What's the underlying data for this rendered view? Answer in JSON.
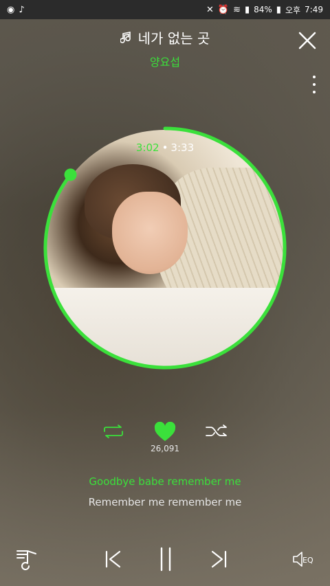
{
  "statusbar": {
    "battery": "84%",
    "ampm": "오후",
    "time": "7:49"
  },
  "track": {
    "title": "네가 없는 곳",
    "artist": "양요섭"
  },
  "progress": {
    "current": "3:02",
    "separator": "•",
    "total": "3:33",
    "fraction": 0.855
  },
  "likes": "26,091",
  "lyrics": {
    "current": "Goodbye babe remember me",
    "next": "Remember me remember me"
  },
  "colors": {
    "accent": "#3be03b"
  },
  "icons": [
    "music-note-icon",
    "close-icon",
    "more-vert-icon",
    "repeat-icon",
    "heart-icon",
    "shuffle-icon",
    "playlist-icon",
    "prev-icon",
    "pause-icon",
    "next-icon",
    "eq-icon"
  ],
  "bottom": {
    "eq_label": "EQ"
  }
}
